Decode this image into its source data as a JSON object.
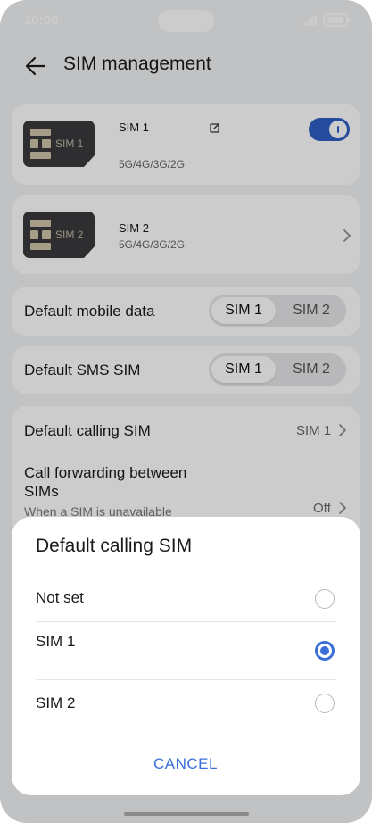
{
  "status_bar": {
    "time": "10:00"
  },
  "header": {
    "title": "SIM management",
    "back_icon": "arrow-left-icon"
  },
  "sims": [
    {
      "chip_label": "SIM 1",
      "name": "SIM 1",
      "network": "5G/4G/3G/2G",
      "enabled": true,
      "edit_icon": "edit-icon"
    },
    {
      "chip_label": "SIM 2",
      "name": "SIM 2",
      "network": "5G/4G/3G/2G"
    }
  ],
  "default_mobile_data": {
    "label": "Default mobile data",
    "options": [
      "SIM 1",
      "SIM 2"
    ],
    "selected": "SIM 1"
  },
  "default_sms": {
    "label": "Default SMS SIM",
    "options": [
      "SIM 1",
      "SIM 2"
    ],
    "selected": "SIM 1"
  },
  "calling": {
    "label": "Default calling SIM",
    "value": "SIM 1",
    "forwarding_label": "Call forwarding between SIMs",
    "forwarding_sub": "When a SIM is unavailable",
    "forwarding_value": "Off"
  },
  "dialog": {
    "title": "Default calling SIM",
    "options": [
      {
        "label": "Not set",
        "checked": false
      },
      {
        "label": "SIM 1",
        "checked": true
      },
      {
        "label": "SIM 2",
        "checked": false
      }
    ],
    "cancel_label": "CANCEL"
  },
  "colors": {
    "accent": "#3a6fd8",
    "toggle_on": "#2f60c4",
    "background": "#f1f3f5"
  }
}
